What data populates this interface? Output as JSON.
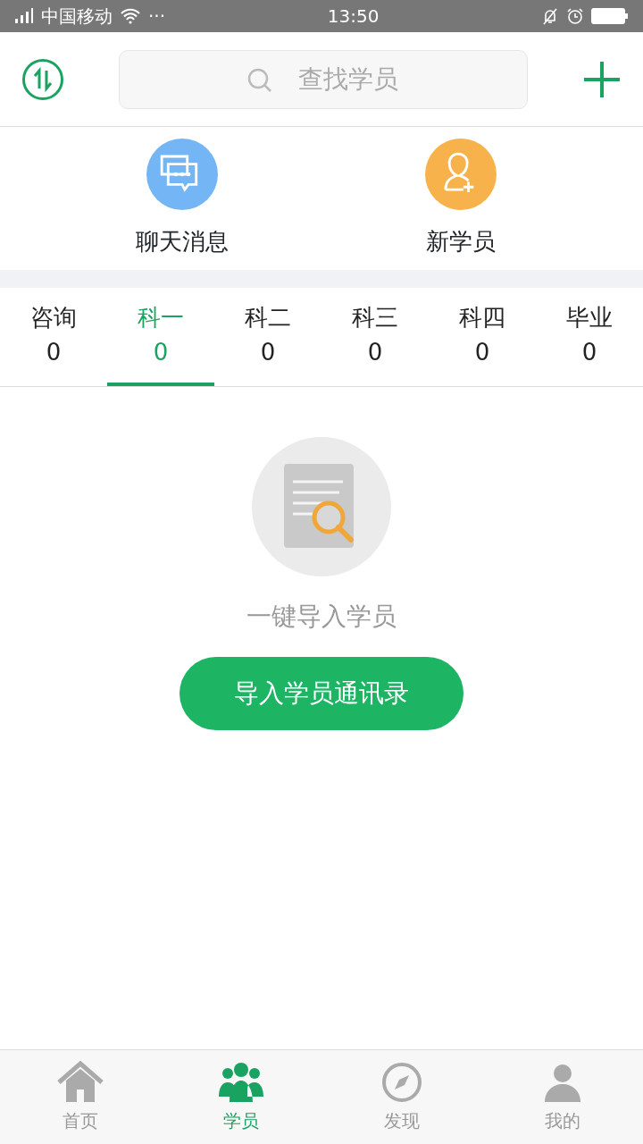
{
  "status_bar": {
    "carrier": "中国移动",
    "more": "···",
    "time": "13:50"
  },
  "header": {
    "search": {
      "placeholder": "查找学员"
    }
  },
  "quick_actions": [
    {
      "label": "聊天消息",
      "kind": "chat"
    },
    {
      "label": "新学员",
      "kind": "new"
    }
  ],
  "tabs": [
    {
      "label": "咨询",
      "count": "0",
      "selected": false
    },
    {
      "label": "科一",
      "count": "0",
      "selected": true
    },
    {
      "label": "科二",
      "count": "0",
      "selected": false
    },
    {
      "label": "科三",
      "count": "0",
      "selected": false
    },
    {
      "label": "科四",
      "count": "0",
      "selected": false
    },
    {
      "label": "毕业",
      "count": "0",
      "selected": false
    }
  ],
  "empty_state": {
    "message": "一键导入学员",
    "button": "导入学员通讯录"
  },
  "bottom_nav": [
    {
      "label": "首页",
      "kind": "home",
      "selected": false
    },
    {
      "label": "学员",
      "kind": "people",
      "selected": true
    },
    {
      "label": "发现",
      "kind": "discover",
      "selected": false
    },
    {
      "label": "我的",
      "kind": "me",
      "selected": false
    }
  ]
}
